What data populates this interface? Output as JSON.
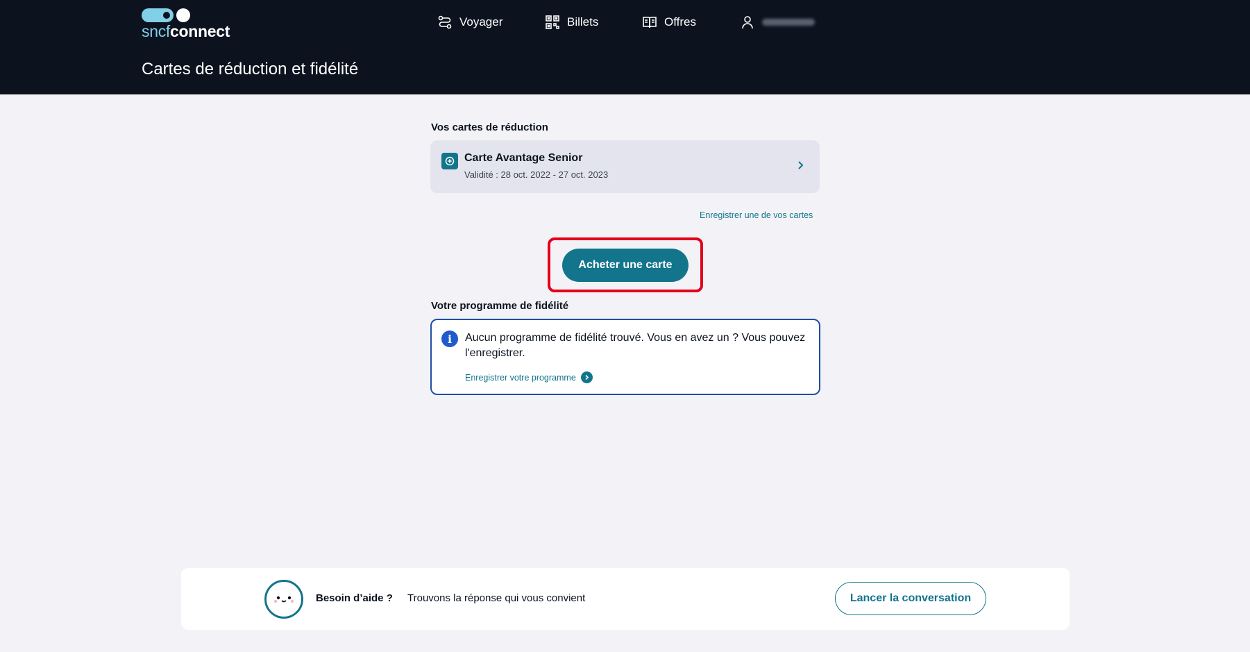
{
  "header": {
    "logo": {
      "part1": "sncf",
      "part2": "connect"
    },
    "nav": {
      "voyager": "Voyager",
      "billets": "Billets",
      "offres": "Offres"
    },
    "page_title": "Cartes de réduction et fidélité"
  },
  "reduction": {
    "section_title": "Vos cartes de réduction",
    "card": {
      "title": "Carte Avantage Senior",
      "validity": "Validité : 28 oct. 2022 - 27 oct. 2023"
    },
    "register_link": "Enregistrer une de vos cartes",
    "buy_button": "Acheter une carte"
  },
  "loyalty": {
    "section_title": "Votre programme de fidélité",
    "info_message": "Aucun programme de fidélité trouvé. Vous en avez un ? Vous pouvez l'enregistrer.",
    "register_link": "Enregistrer votre programme"
  },
  "help": {
    "title": "Besoin d’aide ?",
    "text": "Trouvons la réponse qui vous convient",
    "button": "Lancer la conversation"
  },
  "colors": {
    "header_bg": "#0c131f",
    "accent": "#12758c",
    "highlight": "#e3001b",
    "info_border": "#1f4fa3"
  }
}
